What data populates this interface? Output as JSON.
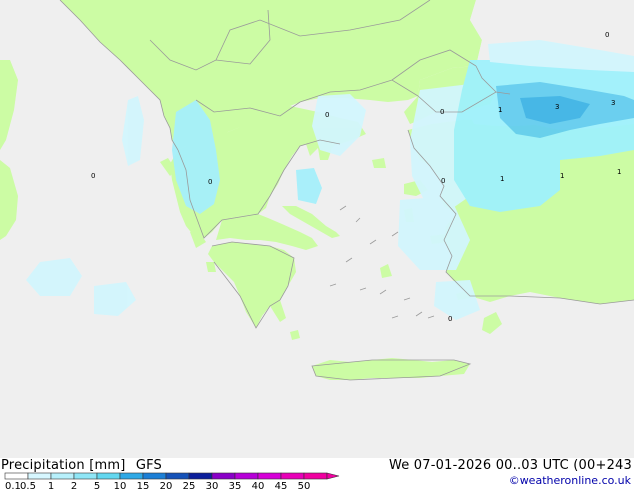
{
  "header": {
    "product": "Precipitation [mm]",
    "model": "GFS",
    "datetime": "We 07-01-2026 00..03 UTC (00+243",
    "credit": "©weatheronline.co.uk"
  },
  "legend": {
    "ticks": [
      "0.1",
      "0.5",
      "1",
      "2",
      "5",
      "10",
      "15",
      "20",
      "25",
      "30",
      "35",
      "40",
      "45",
      "50"
    ],
    "colors": [
      "#ffffff",
      "#d7f7ff",
      "#b7f0fb",
      "#8fe6f6",
      "#63d7ef",
      "#2fa9e6",
      "#1c7fd6",
      "#1552b8",
      "#0c1f9b",
      "#8a00c8",
      "#b600d8",
      "#d600d8",
      "#e800b8",
      "#f000a0"
    ]
  },
  "map": {
    "colors": {
      "sea": "#efefef",
      "land": "#ccfca4",
      "rain_light": "#d2f6fd",
      "rain_mid": "#9ff2fc",
      "rain_heavy": "#64ceef",
      "rain_core": "#3fb5e6",
      "border": "#9a9a9a"
    },
    "labels": [
      {
        "text": "0"
      },
      {
        "text": "0"
      },
      {
        "text": "0"
      },
      {
        "text": "0"
      },
      {
        "text": "1"
      },
      {
        "text": "3"
      },
      {
        "text": "3"
      },
      {
        "text": "0"
      },
      {
        "text": "1"
      },
      {
        "text": "1"
      },
      {
        "text": "1"
      },
      {
        "text": "0"
      },
      {
        "text": "0"
      }
    ]
  }
}
